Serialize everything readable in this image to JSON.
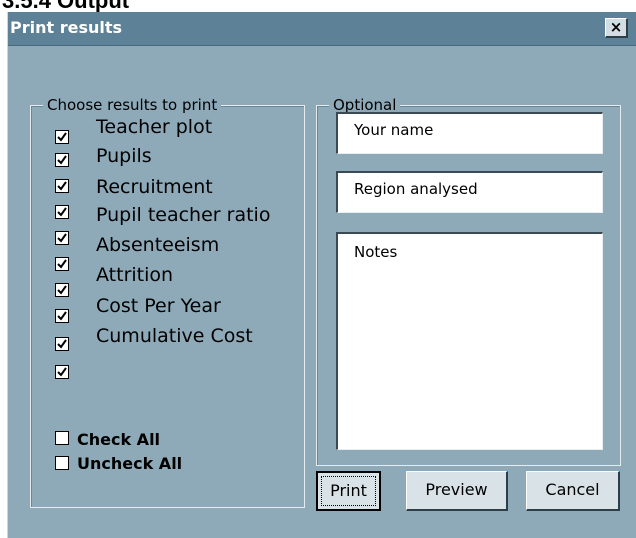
{
  "page": {
    "cropped_heading": "3.5.4 Output"
  },
  "dialog": {
    "title": "Print results",
    "close_glyph": "×",
    "results_group": {
      "legend": "Choose results to print",
      "items": [
        {
          "label": "Teacher plot",
          "checked": true
        },
        {
          "label": "Pupils",
          "checked": true
        },
        {
          "label": "Recruitment",
          "checked": true
        },
        {
          "label": "Pupil teacher ratio",
          "checked": true
        },
        {
          "label": "Absenteeism",
          "checked": true
        },
        {
          "label": "Attrition",
          "checked": true
        },
        {
          "label": "Cost Per Year",
          "checked": true
        },
        {
          "label": "Cumulative Cost",
          "checked": true
        },
        {
          "label": "",
          "checked": true
        },
        {
          "label": "",
          "checked": true
        }
      ],
      "check_all": {
        "label": "Check All",
        "checked": false
      },
      "uncheck_all": {
        "label": "Uncheck All",
        "checked": false
      }
    },
    "optional_group": {
      "legend": "Optional",
      "name_field": "Your name",
      "region_field": "Region analysed",
      "notes_field": "Notes"
    },
    "buttons": {
      "print": "Print",
      "preview": "Preview",
      "cancel": "Cancel"
    }
  }
}
